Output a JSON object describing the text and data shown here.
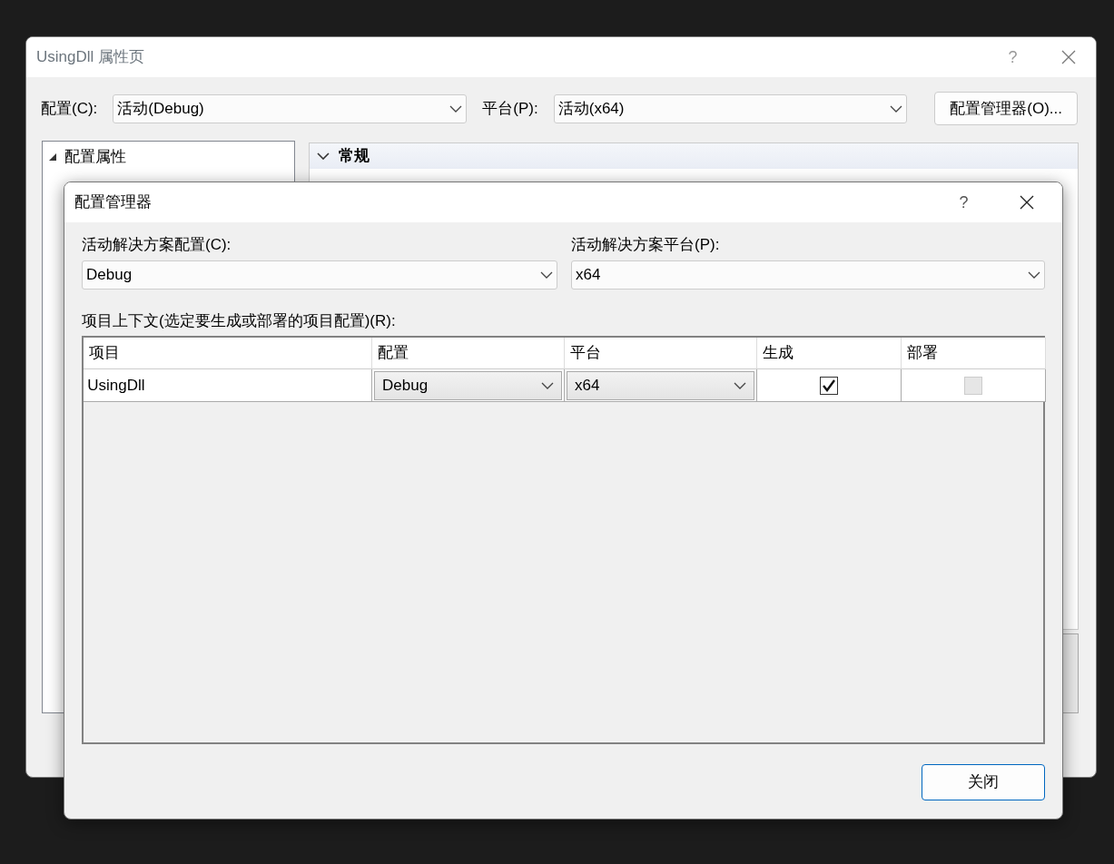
{
  "background_window": {
    "title": "UsingDll 属性页",
    "config_label": "配置(C):",
    "config_value": "活动(Debug)",
    "platform_label": "平台(P):",
    "platform_value": "活动(x64)",
    "manager_button": "配置管理器(O)...",
    "help_button": "?",
    "tree": [
      {
        "label": "配置属性",
        "expanded": true
      }
    ],
    "property_grid": {
      "category": "常规",
      "expanded": true
    }
  },
  "dialog": {
    "title": "配置管理器",
    "help_button": "?",
    "solution_config": {
      "label": "活动解决方案配置(C):",
      "value": "Debug"
    },
    "solution_platform": {
      "label": "活动解决方案平台(P):",
      "value": "x64"
    },
    "context_label": "项目上下文(选定要生成或部署的项目配置)(R):",
    "table": {
      "columns": [
        "项目",
        "配置",
        "平台",
        "生成",
        "部署"
      ],
      "rows": [
        {
          "project": "UsingDll",
          "configuration": "Debug",
          "platform": "x64",
          "build": {
            "checked": true,
            "disabled": false
          },
          "deploy": {
            "checked": false,
            "disabled": true
          }
        }
      ]
    },
    "close_button": "关闭"
  }
}
